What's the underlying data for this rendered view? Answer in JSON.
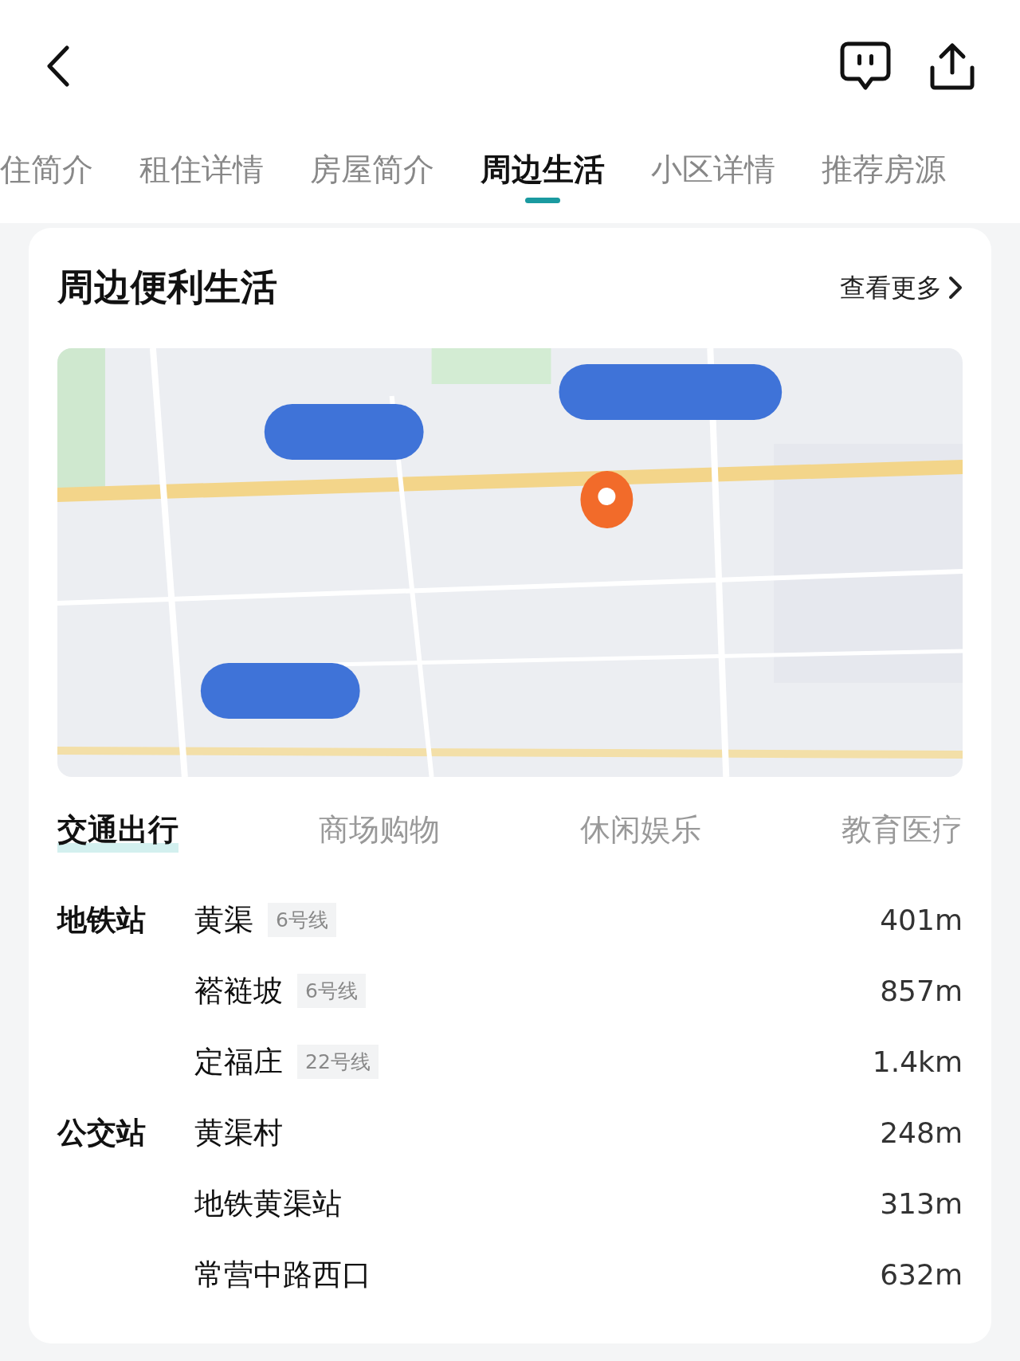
{
  "tabs": [
    {
      "label": "住简介",
      "selected": false
    },
    {
      "label": "租住详情",
      "selected": false
    },
    {
      "label": "房屋简介",
      "selected": false
    },
    {
      "label": "周边生活",
      "selected": true
    },
    {
      "label": "小区详情",
      "selected": false
    },
    {
      "label": "推荐房源",
      "selected": false
    }
  ],
  "section": {
    "title": "周边便利生活",
    "more": "查看更多"
  },
  "categories": [
    {
      "label": "交通出行",
      "selected": true
    },
    {
      "label": "商场购物",
      "selected": false
    },
    {
      "label": "休闲娱乐",
      "selected": false
    },
    {
      "label": "教育医疗",
      "selected": false
    }
  ],
  "groups": [
    {
      "label": "地铁站",
      "items": [
        {
          "name": "黄渠",
          "line": "6号线",
          "distance": "401m"
        },
        {
          "name": "褡裢坡",
          "line": "6号线",
          "distance": "857m"
        },
        {
          "name": "定福庄",
          "line": "22号线",
          "distance": "1.4km"
        }
      ]
    },
    {
      "label": "公交站",
      "items": [
        {
          "name": "黄渠村",
          "distance": "248m"
        },
        {
          "name": "地铁黄渠站",
          "distance": "313m"
        },
        {
          "name": "常营中路西口",
          "distance": "632m"
        }
      ]
    }
  ]
}
